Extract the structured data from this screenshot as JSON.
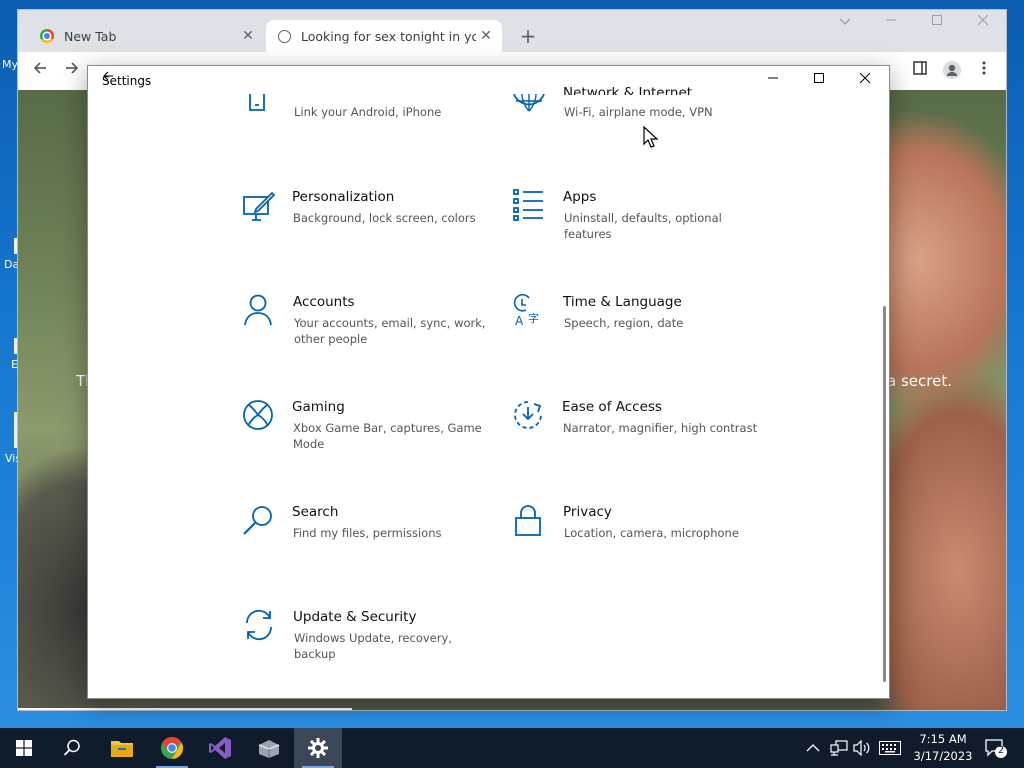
{
  "desktop": {
    "icon_labels": [
      "My",
      "Da",
      "E",
      "Vis"
    ]
  },
  "browser": {
    "tabs": [
      {
        "title": "New Tab"
      },
      {
        "title": "Looking for sex tonight in your a"
      }
    ],
    "close_glyph": "✕",
    "new_tab_glyph": "+",
    "page_text_left": "Tl",
    "page_text_right": "a secret."
  },
  "settings": {
    "title": "Settings",
    "items": [
      {
        "name": "",
        "desc": "Link your Android, iPhone",
        "icon": "phone-icon"
      },
      {
        "name": "Network & Internet",
        "desc": "Wi-Fi, airplane mode, VPN",
        "icon": "globe-icon"
      },
      {
        "name": "Personalization",
        "desc": "Background, lock screen, colors",
        "icon": "personalization-icon"
      },
      {
        "name": "Apps",
        "desc": "Uninstall, defaults, optional features",
        "icon": "apps-icon"
      },
      {
        "name": "Accounts",
        "desc": "Your accounts, email, sync, work, other people",
        "icon": "person-icon"
      },
      {
        "name": "Time & Language",
        "desc": "Speech, region, date",
        "icon": "time-language-icon"
      },
      {
        "name": "Gaming",
        "desc": "Xbox Game Bar, captures, Game Mode",
        "icon": "xbox-icon"
      },
      {
        "name": "Ease of Access",
        "desc": "Narrator, magnifier, high contrast",
        "icon": "ease-of-access-icon"
      },
      {
        "name": "Search",
        "desc": "Find my files, permissions",
        "icon": "search-icon"
      },
      {
        "name": "Privacy",
        "desc": "Location, camera, microphone",
        "icon": "lock-icon"
      },
      {
        "name": "Update & Security",
        "desc": "Windows Update, recovery, backup",
        "icon": "update-icon"
      }
    ],
    "accent": "#0063b1"
  },
  "taskbar": {
    "time": "7:15 AM",
    "date": "3/17/2023",
    "notification_count": "2"
  }
}
